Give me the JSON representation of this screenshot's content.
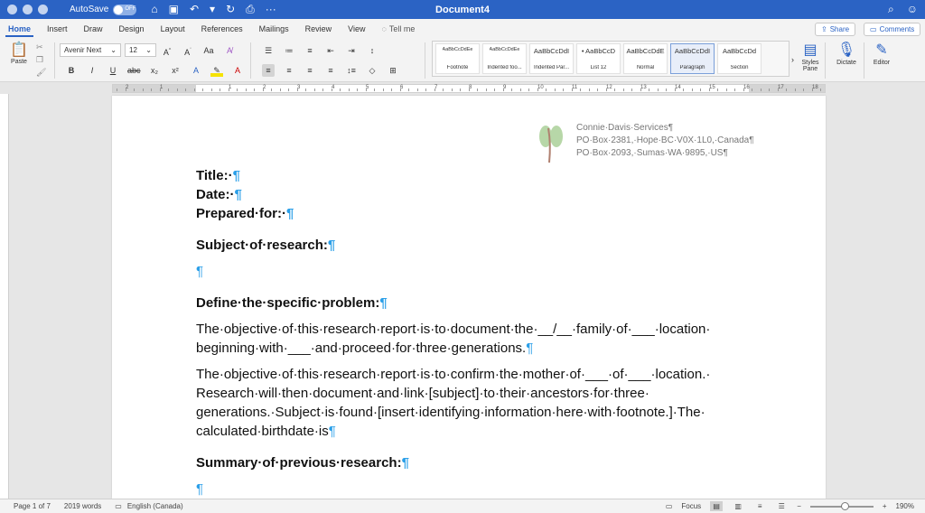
{
  "titlebar": {
    "autosave_label": "AutoSave",
    "autosave_state": "OFF",
    "doc_title": "Document4"
  },
  "tabs": [
    {
      "label": "Home",
      "active": true
    },
    {
      "label": "Insert"
    },
    {
      "label": "Draw"
    },
    {
      "label": "Design"
    },
    {
      "label": "Layout"
    },
    {
      "label": "References"
    },
    {
      "label": "Mailings"
    },
    {
      "label": "Review"
    },
    {
      "label": "View"
    }
  ],
  "tellme": "Tell me",
  "share_label": "Share",
  "comments_label": "Comments",
  "ribbon": {
    "paste_label": "Paste",
    "font_name": "Avenir Next",
    "font_size": "12",
    "styles": [
      {
        "sample": "AaBbCcDdEe",
        "name": "Footnote",
        "small": true
      },
      {
        "sample": "AaBbCcDdEe",
        "name": "Indented foo...",
        "small": true
      },
      {
        "sample": "AaBbCcDdI",
        "name": "Indented Par..."
      },
      {
        "sample": "• AaBbCcD",
        "name": "List 12"
      },
      {
        "sample": "AaBbCcDdE",
        "name": "Normal"
      },
      {
        "sample": "AaBbCcDdI",
        "name": "Paragraph",
        "active": true
      },
      {
        "sample": "AaBbCcDd",
        "name": "Section"
      }
    ],
    "styles_pane_label": "Styles Pane",
    "dictate_label": "Dictate",
    "editor_label": "Editor"
  },
  "ruler_numbers": [
    "2",
    "1",
    "1",
    "2",
    "3",
    "4",
    "5",
    "6",
    "7",
    "8",
    "9",
    "10",
    "11",
    "12",
    "13",
    "14",
    "15",
    "16",
    "17",
    "18"
  ],
  "header": {
    "line1": "Connie·Davis·Services¶",
    "line2": "PO·Box·2381,·Hope·BC·V0X·1L0,·Canada¶",
    "line3": "PO·Box·2093,·Sumas·WA·9895,·US¶"
  },
  "document": {
    "title_label": "Title:",
    "date_label": "Date:",
    "prepared_label": "Prepared·for:",
    "subject_heading": "Subject·of·research:",
    "problem_heading": "Define·the·specific·problem:",
    "para1": "The·objective·of·this·research·report·is·to·document·the·__/__·family·of·___·location· beginning·with·___·and·proceed·for·three·generations.",
    "para2": "The·objective·of·this·research·report·is·to·confirm·the·mother·of·___·of·___·location.· Research·will·then·document·and·link·[subject]·to·their·ancestors·for·three· generations.·Subject·is·found·[insert·identifying·information·here·with·footnote.]·The· calculated·birthdate·is",
    "summary_heading": "Summary·of·previous·research:",
    "pilcrow": "¶"
  },
  "status": {
    "page": "Page 1 of 7",
    "words": "2019 words",
    "language": "English (Canada)",
    "focus": "Focus",
    "zoom": "190%",
    "zoom_fraction": 0.55
  }
}
